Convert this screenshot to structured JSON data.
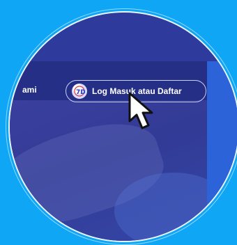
{
  "nav": {
    "partial_link": "ami",
    "login_label": "Log Masuk atau Daftar",
    "login_icon": "logo-badge-icon"
  },
  "colors": {
    "background": "#0ea6f5",
    "header": "#262f86",
    "hero": "#323b96",
    "button_border": "#c9d2ff"
  }
}
